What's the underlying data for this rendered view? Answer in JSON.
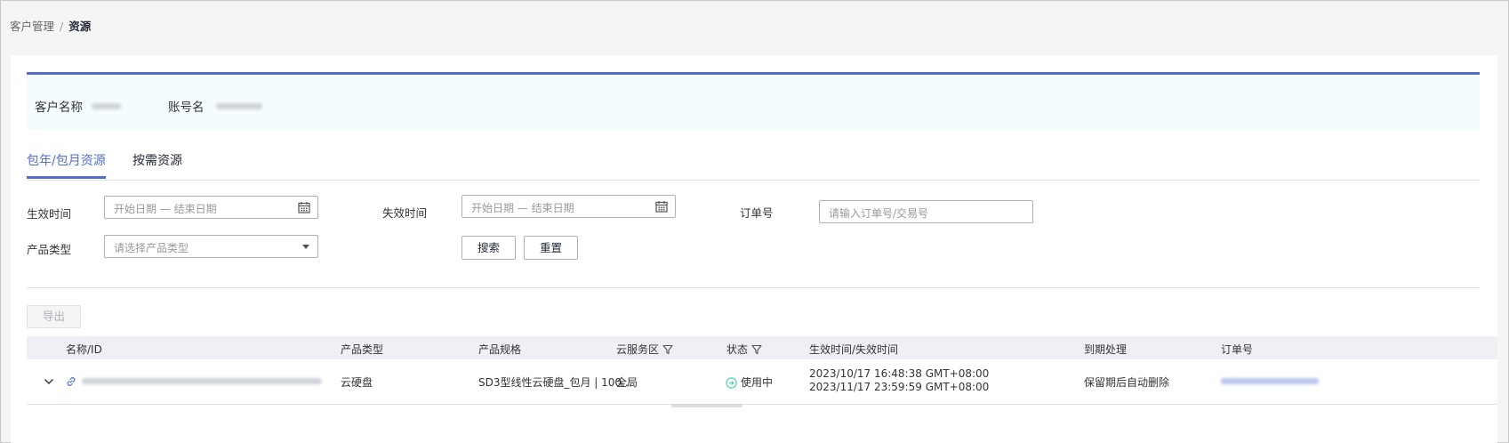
{
  "breadcrumb": {
    "parent": "客户管理",
    "separator": "/",
    "current": "资源"
  },
  "customer_info": {
    "name_label": "客户名称",
    "account_label": "账号名"
  },
  "tabs": [
    {
      "label": "包年/包月资源",
      "active": true
    },
    {
      "label": "按需资源",
      "active": false
    }
  ],
  "filters": {
    "effective_time_label": "生效时间",
    "effective_time_placeholder": "开始日期 — 结束日期",
    "expire_time_label": "失效时间",
    "expire_time_placeholder": "开始日期 — 结束日期",
    "order_no_label": "订单号",
    "order_no_placeholder": "请输入订单号/交易号",
    "product_type_label": "产品类型",
    "product_type_placeholder": "请选择产品类型",
    "search_button": "搜索",
    "reset_button": "重置"
  },
  "export_button": "导出",
  "table": {
    "columns": [
      "名称/ID",
      "产品类型",
      "产品规格",
      "云服务区",
      "状态",
      "生效时间/失效时间",
      "到期处理",
      "订单号"
    ],
    "rows": [
      {
        "product_type": "云硬盘",
        "spec": "SD3型线性云硬盘_包月 | 100...",
        "region": "全局",
        "status": "使用中",
        "effective_time": "2023/10/17 16:48:38 GMT+08:00",
        "expire_time": "2023/11/17 23:59:59 GMT+08:00",
        "expiry_action": "保留期后自动删除"
      }
    ]
  },
  "colors": {
    "accent": "#526ecc",
    "status_ok": "#50d4ab",
    "link": "#526ecc"
  }
}
